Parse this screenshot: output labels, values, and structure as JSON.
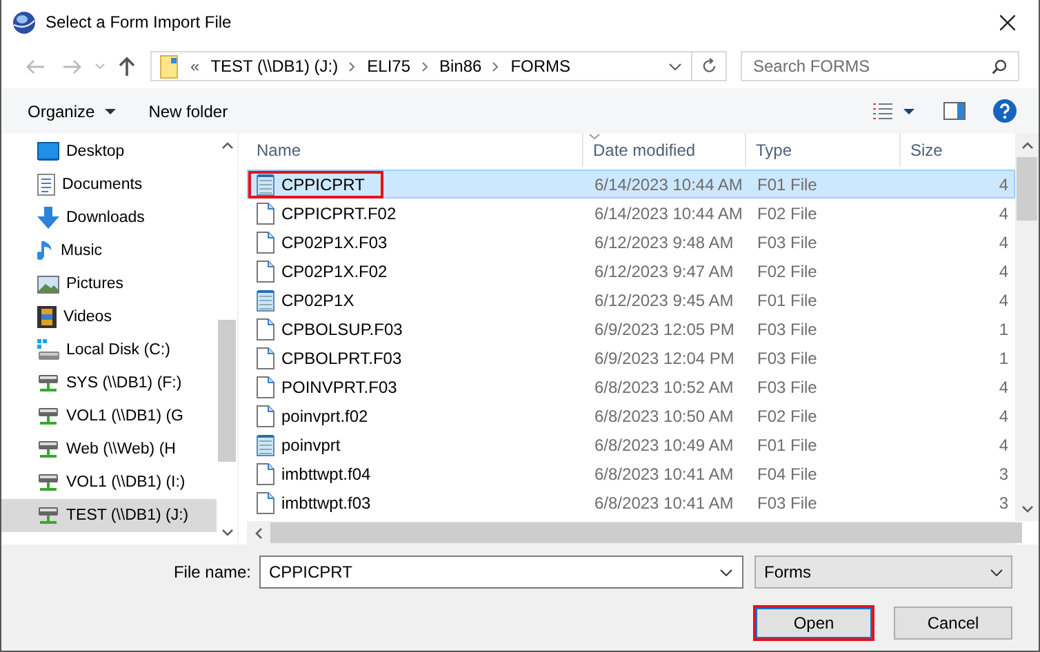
{
  "window": {
    "title": "Select a Form Import File"
  },
  "address": {
    "overflow": "«",
    "segments": [
      "TEST (\\\\DB1) (J:)",
      "ELI75",
      "Bin86",
      "FORMS"
    ]
  },
  "search": {
    "placeholder": "Search FORMS"
  },
  "toolbar": {
    "buttons": [
      "Organize",
      "New folder"
    ]
  },
  "sidebar": {
    "items": [
      {
        "label": "Desktop",
        "kind": "desktop",
        "selected": false
      },
      {
        "label": "Documents",
        "kind": "documents",
        "selected": false
      },
      {
        "label": "Downloads",
        "kind": "downloads",
        "selected": false
      },
      {
        "label": "Music",
        "kind": "music",
        "selected": false
      },
      {
        "label": "Pictures",
        "kind": "pictures",
        "selected": false
      },
      {
        "label": "Videos",
        "kind": "videos",
        "selected": false
      },
      {
        "label": "Local Disk (C:)",
        "kind": "disk",
        "selected": false
      },
      {
        "label": "SYS (\\\\DB1) (F:)",
        "kind": "netdrive",
        "selected": false
      },
      {
        "label": "VOL1 (\\\\DB1) (G",
        "kind": "netdrive",
        "selected": false
      },
      {
        "label": "Web (\\\\Web) (H",
        "kind": "netdrive",
        "selected": false
      },
      {
        "label": "VOL1 (\\\\DB1) (I:)",
        "kind": "netdrive",
        "selected": false
      },
      {
        "label": "TEST (\\\\DB1) (J:)",
        "kind": "netdrive",
        "selected": true
      }
    ]
  },
  "table": {
    "columns": [
      "Name",
      "Date modified",
      "Type",
      "Size"
    ],
    "rows": [
      {
        "name": "CPPICPRT",
        "date": "6/14/2023 10:44 AM",
        "type": "F01 File",
        "size": "4",
        "kind": "notepad",
        "selected": true,
        "annotated": true
      },
      {
        "name": "CPPICPRT.F02",
        "date": "6/14/2023 10:44 AM",
        "type": "F02 File",
        "size": "4",
        "kind": "blank",
        "selected": false,
        "annotated": false
      },
      {
        "name": "CP02P1X.F03",
        "date": "6/12/2023 9:48 AM",
        "type": "F03 File",
        "size": "4",
        "kind": "blank",
        "selected": false,
        "annotated": false
      },
      {
        "name": "CP02P1X.F02",
        "date": "6/12/2023 9:47 AM",
        "type": "F02 File",
        "size": "4",
        "kind": "blank",
        "selected": false,
        "annotated": false
      },
      {
        "name": "CP02P1X",
        "date": "6/12/2023 9:45 AM",
        "type": "F01 File",
        "size": "4",
        "kind": "notepad",
        "selected": false,
        "annotated": false
      },
      {
        "name": "CPBOLSUP.F03",
        "date": "6/9/2023 12:05 PM",
        "type": "F03 File",
        "size": "1",
        "kind": "blank",
        "selected": false,
        "annotated": false
      },
      {
        "name": "CPBOLPRT.F03",
        "date": "6/9/2023 12:04 PM",
        "type": "F03 File",
        "size": "1",
        "kind": "blank",
        "selected": false,
        "annotated": false
      },
      {
        "name": "POINVPRT.F03",
        "date": "6/8/2023 10:52 AM",
        "type": "F03 File",
        "size": "4",
        "kind": "blank",
        "selected": false,
        "annotated": false
      },
      {
        "name": "poinvprt.f02",
        "date": "6/8/2023 10:50 AM",
        "type": "F02 File",
        "size": "4",
        "kind": "blank",
        "selected": false,
        "annotated": false
      },
      {
        "name": "poinvprt",
        "date": "6/8/2023 10:49 AM",
        "type": "F01 File",
        "size": "4",
        "kind": "notepad",
        "selected": false,
        "annotated": false
      },
      {
        "name": "imbttwpt.f04",
        "date": "6/8/2023 10:41 AM",
        "type": "F04 File",
        "size": "3",
        "kind": "blank",
        "selected": false,
        "annotated": false
      },
      {
        "name": "imbttwpt.f03",
        "date": "6/8/2023 10:41 AM",
        "type": "F03 File",
        "size": "3",
        "kind": "blank",
        "selected": false,
        "annotated": false
      }
    ]
  },
  "footer": {
    "filename_label": "File name:",
    "filename_value": "CPPICPRT",
    "filter": "Forms",
    "open": {
      "label": "Open",
      "annotated": true
    },
    "cancel": {
      "label": "Cancel"
    }
  }
}
